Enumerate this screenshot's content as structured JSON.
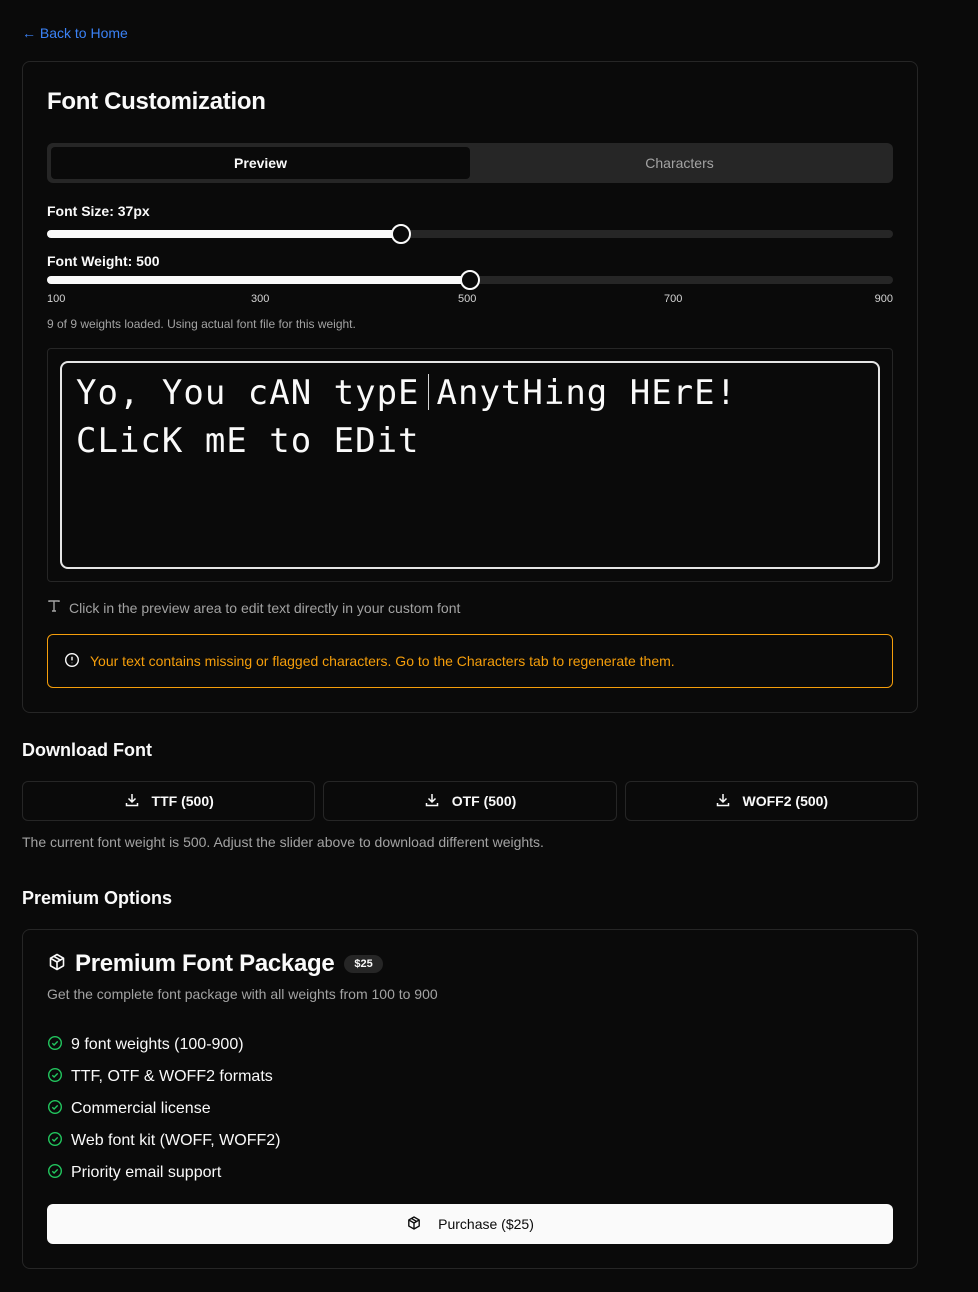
{
  "nav": {
    "back_label": "← Back to Home"
  },
  "customization": {
    "title": "Font Customization",
    "tabs": [
      {
        "label": "Preview",
        "active": true
      },
      {
        "label": "Characters",
        "active": false
      }
    ],
    "font_size": {
      "label": "Font Size: 37px",
      "value": 37,
      "fraction": 0.418
    },
    "font_weight": {
      "label": "Font Weight: 500",
      "value": 500,
      "fraction": 0.5,
      "ticks": [
        "100",
        "300",
        "500",
        "700",
        "900"
      ]
    },
    "weights_note": "9 of 9 weights loaded. Using actual font file for this weight.",
    "preview": {
      "text_before_caret": "Yo, You cAN typE",
      "text_after_caret": "AnytHing HErE! CLicK mE to EDit"
    },
    "hint": "Click in the preview area to edit text directly in your custom font",
    "warning": "Your text contains missing or flagged characters. Go to the Characters tab to regenerate them."
  },
  "download": {
    "title": "Download Font",
    "buttons": [
      {
        "label": "TTF (500)",
        "icon": "download-icon"
      },
      {
        "label": "OTF (500)",
        "icon": "download-icon"
      },
      {
        "label": "WOFF2 (500)",
        "icon": "download-icon"
      }
    ],
    "note": "The current font weight is 500. Adjust the slider above to download different weights."
  },
  "premium": {
    "section_title": "Premium Options",
    "package_title": "Premium Font Package",
    "price_badge": "$25",
    "description": "Get the complete font package with all weights from 100 to 900",
    "features": [
      "9 font weights (100-900)",
      "TTF, OTF & WOFF2 formats",
      "Commercial license",
      "Web font kit (WOFF, WOFF2)",
      "Priority email support"
    ],
    "purchase_label": "Purchase ($25)"
  },
  "colors": {
    "background": "#0a0a0a",
    "border": "#262626",
    "link": "#3b82f6",
    "warning": "#f59e0b",
    "success": "#22c55e"
  }
}
